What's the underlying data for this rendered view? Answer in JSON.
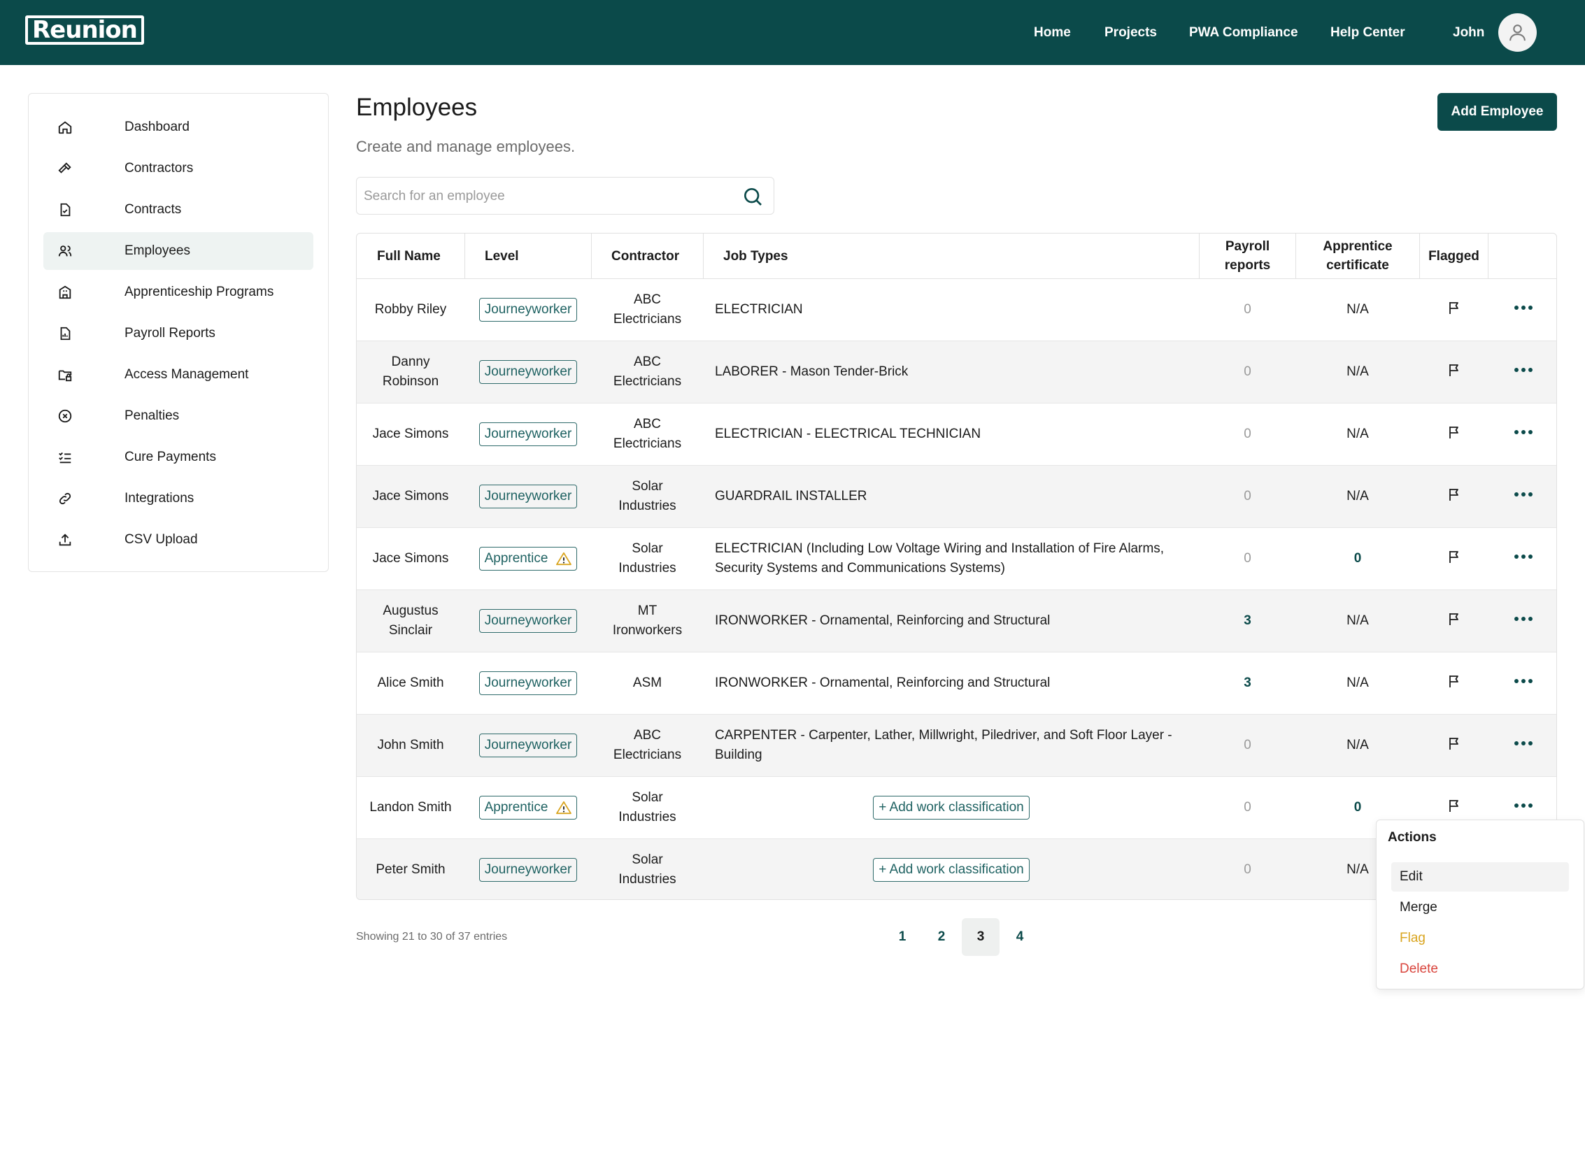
{
  "app": {
    "logo": "Reunion"
  },
  "topnav": {
    "items": [
      "Home",
      "Projects",
      "PWA Compliance",
      "Help Center"
    ],
    "user_name": "John"
  },
  "sidebar": {
    "items": [
      {
        "label": "Dashboard",
        "icon": "home-icon",
        "active": false
      },
      {
        "label": "Contractors",
        "icon": "hammer-icon",
        "active": false
      },
      {
        "label": "Contracts",
        "icon": "document-check-icon",
        "active": false
      },
      {
        "label": "Employees",
        "icon": "users-icon",
        "active": true
      },
      {
        "label": "Apprenticeship Programs",
        "icon": "building-icon",
        "active": false
      },
      {
        "label": "Payroll Reports",
        "icon": "report-icon",
        "active": false
      },
      {
        "label": "Access Management",
        "icon": "folder-lock-icon",
        "active": false
      },
      {
        "label": "Penalties",
        "icon": "x-circle-icon",
        "active": false
      },
      {
        "label": "Cure Payments",
        "icon": "checklist-icon",
        "active": false
      },
      {
        "label": "Integrations",
        "icon": "link-icon",
        "active": false
      },
      {
        "label": "CSV Upload",
        "icon": "upload-icon",
        "active": false
      }
    ]
  },
  "page": {
    "title": "Employees",
    "subtitle": "Create and manage employees.",
    "add_button": "Add Employee"
  },
  "search": {
    "placeholder": "Search for an employee",
    "value": ""
  },
  "table": {
    "headers": {
      "full_name": "Full Name",
      "level": "Level",
      "contractor": "Contractor",
      "job_types": "Job Types",
      "payroll_1": "Payroll",
      "payroll_2": "reports",
      "cert_1": "Apprentice",
      "cert_2": "certificate",
      "flagged": "Flagged"
    },
    "add_classification_label": "+ Add work classification",
    "rows": [
      {
        "name": [
          "Robby Riley"
        ],
        "level": "Journeyworker",
        "warn": false,
        "contractor": [
          "ABC",
          "Electricians"
        ],
        "job": [
          "ELECTRICIAN"
        ],
        "payroll": "0",
        "cert": "N/A"
      },
      {
        "name": [
          "Danny",
          "Robinson"
        ],
        "level": "Journeyworker",
        "warn": false,
        "contractor": [
          "ABC",
          "Electricians"
        ],
        "job": [
          "LABORER - Mason Tender-Brick"
        ],
        "payroll": "0",
        "cert": "N/A"
      },
      {
        "name": [
          "Jace Simons"
        ],
        "level": "Journeyworker",
        "warn": false,
        "contractor": [
          "ABC",
          "Electricians"
        ],
        "job": [
          "ELECTRICIAN - ELECTRICAL TECHNICIAN"
        ],
        "payroll": "0",
        "cert": "N/A"
      },
      {
        "name": [
          "Jace Simons"
        ],
        "level": "Journeyworker",
        "warn": false,
        "contractor": [
          "Solar",
          "Industries"
        ],
        "job": [
          "GUARDRAIL INSTALLER"
        ],
        "payroll": "0",
        "cert": "N/A"
      },
      {
        "name": [
          "Jace Simons"
        ],
        "level": "Apprentice",
        "warn": true,
        "contractor": [
          "Solar",
          "Industries"
        ],
        "job": [
          "ELECTRICIAN (Including Low Voltage Wiring and Installation of Fire Alarms,",
          "Security Systems and Communications Systems)"
        ],
        "payroll": "0",
        "cert": "0"
      },
      {
        "name": [
          "Augustus",
          "Sinclair"
        ],
        "level": "Journeyworker",
        "warn": false,
        "contractor": [
          "MT",
          "Ironworkers"
        ],
        "job": [
          "IRONWORKER - Ornamental, Reinforcing and Structural"
        ],
        "payroll": "3",
        "cert": "N/A"
      },
      {
        "name": [
          "Alice Smith"
        ],
        "level": "Journeyworker",
        "warn": false,
        "contractor": [
          "ASM"
        ],
        "job": [
          "IRONWORKER - Ornamental, Reinforcing and Structural"
        ],
        "payroll": "3",
        "cert": "N/A"
      },
      {
        "name": [
          "John Smith"
        ],
        "level": "Journeyworker",
        "warn": false,
        "contractor": [
          "ABC",
          "Electricians"
        ],
        "job": [
          "CARPENTER - Carpenter, Lather, Millwright, Piledriver, and Soft Floor Layer -",
          "Building"
        ],
        "payroll": "0",
        "cert": "N/A"
      },
      {
        "name": [
          "Landon Smith"
        ],
        "level": "Apprentice",
        "warn": true,
        "contractor": [
          "Solar",
          "Industries"
        ],
        "job": [],
        "payroll": "0",
        "cert": "0"
      },
      {
        "name": [
          "Peter Smith"
        ],
        "level": "Journeyworker",
        "warn": false,
        "contractor": [
          "Solar",
          "Industries"
        ],
        "job": [],
        "payroll": "0",
        "cert": "N/A"
      }
    ]
  },
  "pagination": {
    "showing": "Showing 21 to 30 of 37 entries",
    "pages": [
      "1",
      "2",
      "3",
      "4"
    ],
    "current": "3"
  },
  "actions_menu": {
    "title": "Actions",
    "items": [
      {
        "label": "Edit",
        "color": "#1b1b1b"
      },
      {
        "label": "Merge",
        "color": "#1b1b1b"
      },
      {
        "label": "Flag",
        "color": "#d9a520"
      },
      {
        "label": "Delete",
        "color": "#d9453d"
      }
    ]
  },
  "colors": {
    "brand": "#0b4a4a",
    "accent_text": "#1f6262",
    "warning": "#d9a520",
    "danger": "#d9453d"
  }
}
